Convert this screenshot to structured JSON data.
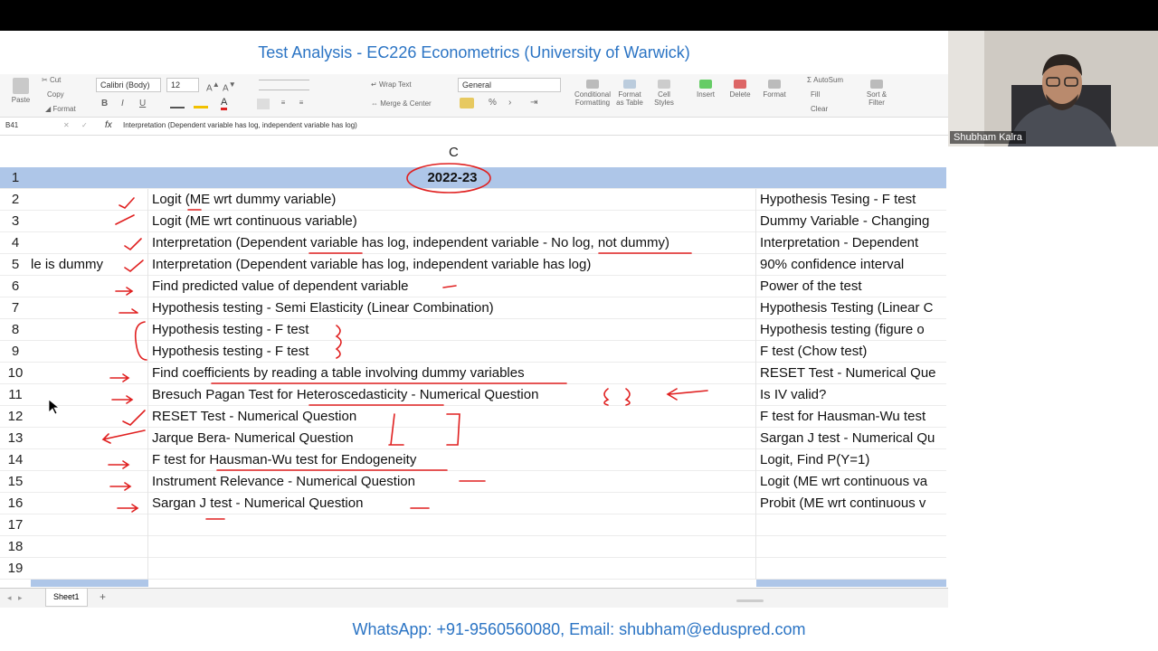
{
  "banner_title": "Test Analysis - EC226 Econometrics (University of Warwick)",
  "footer_contact": "WhatsApp: +91-9560560080, Email: shubham@eduspred.com",
  "webcam": {
    "name": "Shubham Kalra"
  },
  "ribbon": {
    "paste": "Paste",
    "cut": "Cut",
    "copy": "Copy",
    "format": "Format",
    "font_name": "Calibri (Body)",
    "font_size": "12",
    "bold": "B",
    "italic": "I",
    "underline": "U",
    "wrap_text": "Wrap Text",
    "merge_center": "Merge & Center",
    "number_format": "General",
    "percent": "%",
    "conditional_formatting": "Conditional Formatting",
    "format_as_table": "Format as Table",
    "cell_styles": "Cell Styles",
    "insert": "Insert",
    "delete": "Delete",
    "format_cells": "Format",
    "autosum": "AutoSum",
    "fill": "Fill",
    "clear": "Clear",
    "sort_filter": "Sort & Filter"
  },
  "formula_bar": {
    "name_box": "B41",
    "fx": "fx",
    "content": "Interpretation (Dependent variable has log, independent variable has log)"
  },
  "column_header": "C",
  "rows": [
    {
      "n": "1",
      "b": "",
      "c": "2022-23",
      "d": ""
    },
    {
      "n": "2",
      "b": "",
      "c": "Logit (ME wrt dummy variable)",
      "d": "Hypothesis Tesing - F test"
    },
    {
      "n": "3",
      "b": "",
      "c": "Logit (ME wrt continuous variable)",
      "d": "Dummy Variable - Changing"
    },
    {
      "n": "4",
      "b": "",
      "c": "Interpretation (Dependent variable has log, independent variable - No log, not dummy)",
      "d": "Interpretation - Dependent"
    },
    {
      "n": "5",
      "b": "le is dummy",
      "c": "Interpretation (Dependent variable has log, independent variable has log)",
      "d": "90% confidence interval"
    },
    {
      "n": "6",
      "b": "",
      "c": "Find predicted value of dependent variable",
      "d": "Power of the test"
    },
    {
      "n": "7",
      "b": "",
      "c": "Hypothesis testing - Semi Elasticity (Linear Combination)",
      "d": "Hypothesis Testing (Linear C"
    },
    {
      "n": "8",
      "b": "",
      "c": "Hypothesis testing - F test",
      "d": "Hypothesis testing (figure o"
    },
    {
      "n": "9",
      "b": "",
      "c": "Hypothesis testing - F test",
      "d": "F test (Chow test)"
    },
    {
      "n": "10",
      "b": "",
      "c": "Find coefficients by reading a table involving dummy variables",
      "d": "RESET Test - Numerical Que"
    },
    {
      "n": "11",
      "b": "",
      "c": "Bresuch Pagan Test for Heteroscedasticity - Numerical Question",
      "d": "Is IV valid?"
    },
    {
      "n": "12",
      "b": "",
      "c": "RESET Test - Numerical Question",
      "d": "F test for Hausman-Wu test"
    },
    {
      "n": "13",
      "b": "",
      "c": "Jarque Bera- Numerical Question",
      "d": "Sargan J test - Numerical Qu"
    },
    {
      "n": "14",
      "b": "",
      "c": "F test for Hausman-Wu test for Endogeneity",
      "d": "Logit, Find P(Y=1)"
    },
    {
      "n": "15",
      "b": "",
      "c": "Instrument Relevance - Numerical Question",
      "d": "Logit (ME wrt continuous va"
    },
    {
      "n": "16",
      "b": "",
      "c": "Sargan J test - Numerical Question",
      "d": "Probit (ME wrt continuous v"
    },
    {
      "n": "17",
      "b": "",
      "c": "",
      "d": ""
    },
    {
      "n": "18",
      "b": "",
      "c": "",
      "d": ""
    },
    {
      "n": "19",
      "b": "",
      "c": "",
      "d": ""
    }
  ],
  "sheet_tab": "Sheet1",
  "add_sheet": "+",
  "colors": {
    "accent": "#2b74c4",
    "header_fill": "#aec6e8",
    "ink": "#e02020"
  }
}
